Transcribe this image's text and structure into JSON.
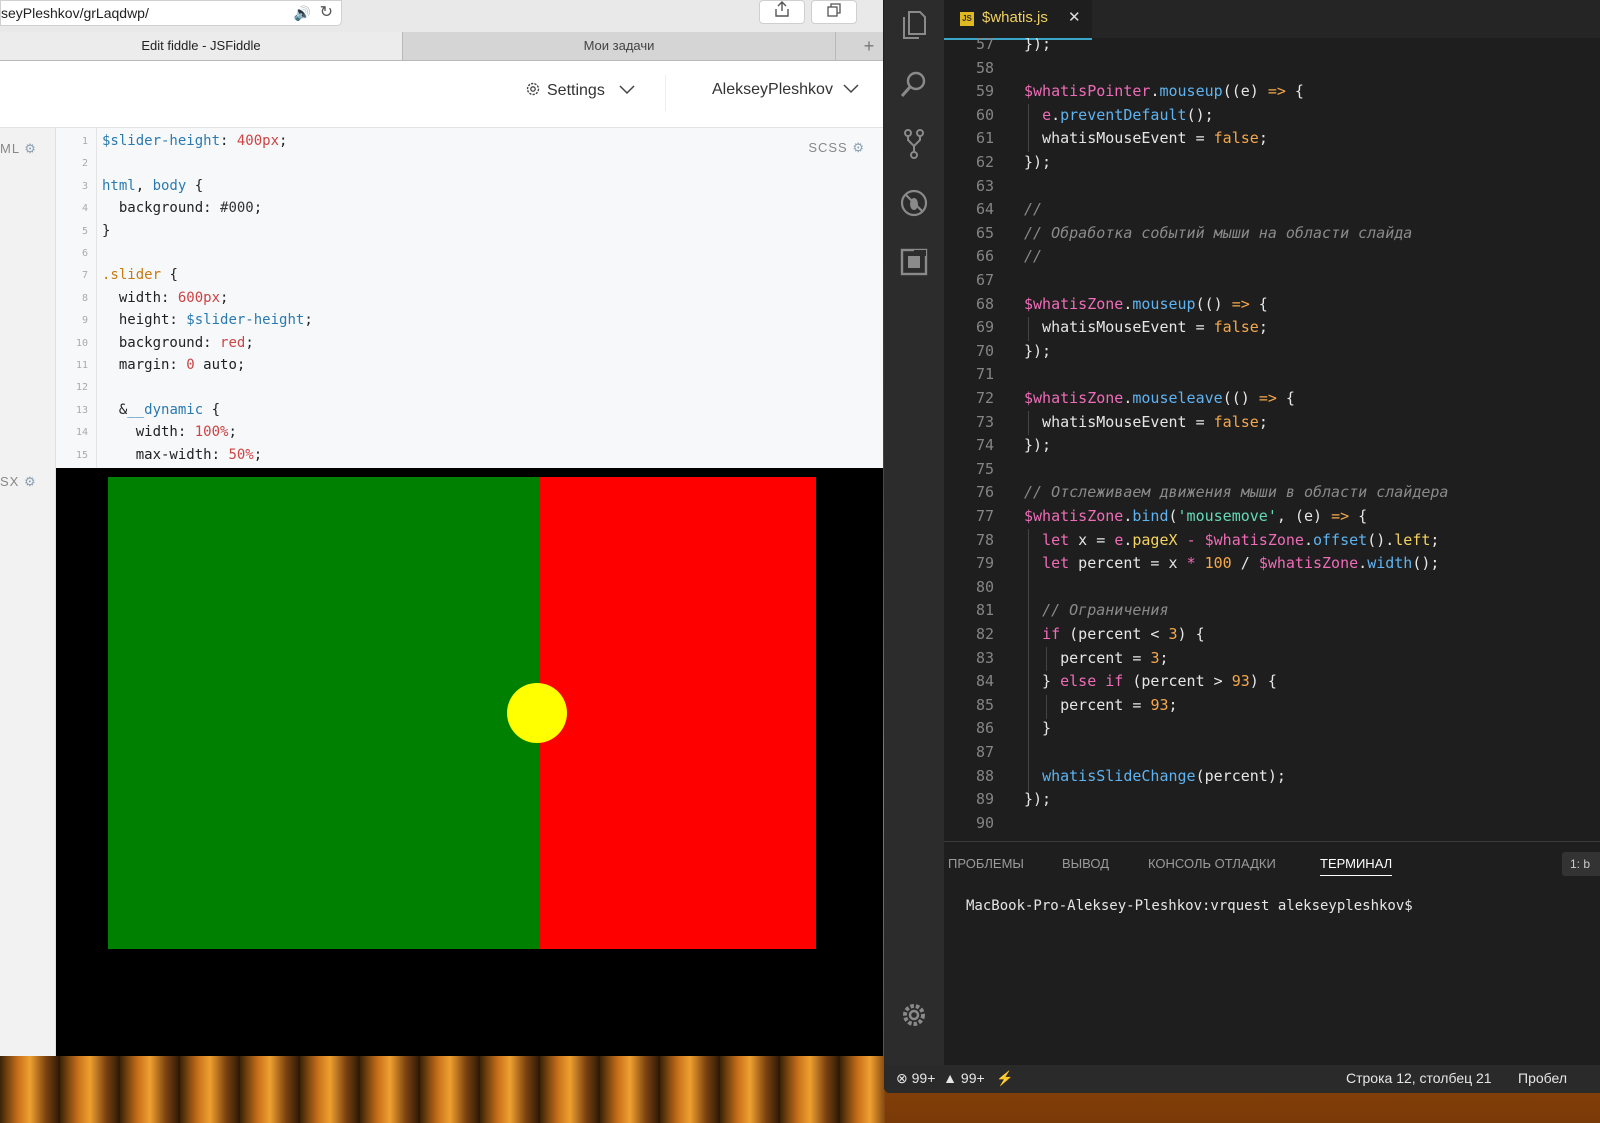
{
  "browser": {
    "url": "seyPleshkov/grLaqdwp/",
    "tabs": [
      "Edit fiddle - JSFiddle",
      "Мои задачи"
    ],
    "tab_plus": "+",
    "header": {
      "settings_label": "Settings",
      "user_label": "AlekseyPleshkov"
    },
    "pane_labels": {
      "html": "ML",
      "css": "SCSS",
      "js": "SX"
    }
  },
  "scss_lines": [
    {
      "n": "1",
      "html": "<span class=\"c-var\">$slider-height</span>: <span class=\"c-val\">400px</span>;"
    },
    {
      "n": "2",
      "html": ""
    },
    {
      "n": "3",
      "html": "<span class=\"c-kw\">html</span>, <span class=\"c-kw\">body</span> {"
    },
    {
      "n": "4",
      "html": "  background: <span class=\"c-hex\">#000</span>;"
    },
    {
      "n": "5",
      "html": "}"
    },
    {
      "n": "6",
      "html": ""
    },
    {
      "n": "7",
      "html": "<span class=\"c-sel\">.slider</span> {"
    },
    {
      "n": "8",
      "html": "  width: <span class=\"c-val\">600px</span>;"
    },
    {
      "n": "9",
      "html": "  height: <span class=\"c-var\">$slider-height</span>;"
    },
    {
      "n": "10",
      "html": "  background: <span class=\"c-val\">red</span>;"
    },
    {
      "n": "11",
      "html": "  margin: <span class=\"c-val\">0</span> auto;"
    },
    {
      "n": "12",
      "html": ""
    },
    {
      "n": "13",
      "html": "  &amp;<span class=\"c-kw\">__dynamic</span> {"
    },
    {
      "n": "14",
      "html": "    width: <span class=\"c-val\">100%</span>;"
    },
    {
      "n": "15",
      "html": "    max-width: <span class=\"c-val\">50%</span>;"
    }
  ],
  "result": {
    "left_color": "#008000",
    "right_color": "#ff0000",
    "handle_color": "#ffff00"
  },
  "vscode": {
    "tab_name": "$whatis.js",
    "tab_badge": "JS",
    "code_lines": [
      {
        "n": "57",
        "html": "});"
      },
      {
        "n": "58",
        "html": ""
      },
      {
        "n": "59",
        "html": "<span class=\"k-pink\">$whatisPointer</span>.<span class=\"k-blue\">mouseup</span>((e) <span class=\"k-orange\">=&gt;</span> {"
      },
      {
        "n": "60",
        "html": "  <span class=\"k-pink\">e</span>.<span class=\"k-blue\">preventDefault</span>();"
      },
      {
        "n": "61",
        "html": "  whatisMouseEvent = <span class=\"k-orange\">false</span>;"
      },
      {
        "n": "62",
        "html": "});"
      },
      {
        "n": "63",
        "html": ""
      },
      {
        "n": "64",
        "html": "<span class=\"k-cmt\">//</span>"
      },
      {
        "n": "65",
        "html": "<span class=\"k-cmt\">// Обработка событий мыши на области слайда</span>"
      },
      {
        "n": "66",
        "html": "<span class=\"k-cmt\">//</span>"
      },
      {
        "n": "67",
        "html": ""
      },
      {
        "n": "68",
        "html": "<span class=\"k-pink\">$whatisZone</span>.<span class=\"k-blue\">mouseup</span>(() <span class=\"k-orange\">=&gt;</span> {"
      },
      {
        "n": "69",
        "html": "  whatisMouseEvent = <span class=\"k-orange\">false</span>;"
      },
      {
        "n": "70",
        "html": "});"
      },
      {
        "n": "71",
        "html": ""
      },
      {
        "n": "72",
        "html": "<span class=\"k-pink\">$whatisZone</span>.<span class=\"k-blue\">mouseleave</span>(() <span class=\"k-orange\">=&gt;</span> {"
      },
      {
        "n": "73",
        "html": "  whatisMouseEvent = <span class=\"k-orange\">false</span>;"
      },
      {
        "n": "74",
        "html": "});"
      },
      {
        "n": "75",
        "html": ""
      },
      {
        "n": "76",
        "html": "<span class=\"k-cmt\">// Отслеживаем движения мыши в области слайдера</span>"
      },
      {
        "n": "77",
        "html": "<span class=\"k-pink\">$whatisZone</span>.<span class=\"k-blue\">bind</span>(<span class=\"k-str\">'mousemove'</span>, (e) <span class=\"k-orange\">=&gt;</span> {"
      },
      {
        "n": "78",
        "html": "  <span class=\"k-pink\">let</span> x = <span class=\"k-pink\">e</span>.<span class=\"k-yel\">pageX</span> <span class=\"k-pink\">-</span> <span class=\"k-pink\">$whatisZone</span>.<span class=\"k-blue\">offset</span>().<span class=\"k-yel\">left</span>;"
      },
      {
        "n": "79",
        "html": "  <span class=\"k-pink\">let</span> percent = x <span class=\"k-pink\">*</span> <span class=\"k-orange\">100</span> / <span class=\"k-pink\">$whatisZone</span>.<span class=\"k-blue\">width</span>();"
      },
      {
        "n": "80",
        "html": ""
      },
      {
        "n": "81",
        "html": "  <span class=\"k-cmt\">// Ограничения</span>"
      },
      {
        "n": "82",
        "html": "  <span class=\"k-pink\">if</span> (percent &lt; <span class=\"k-orange\">3</span>) {"
      },
      {
        "n": "83",
        "html": "    percent = <span class=\"k-orange\">3</span>;"
      },
      {
        "n": "84",
        "html": "  } <span class=\"k-pink\">else if</span> (percent &gt; <span class=\"k-orange\">93</span>) {"
      },
      {
        "n": "85",
        "html": "    percent = <span class=\"k-orange\">93</span>;"
      },
      {
        "n": "86",
        "html": "  }"
      },
      {
        "n": "87",
        "html": ""
      },
      {
        "n": "88",
        "html": "  <span class=\"k-blue\">whatisSlideChange</span>(percent);"
      },
      {
        "n": "89",
        "html": "});"
      },
      {
        "n": "90",
        "html": ""
      }
    ],
    "panel_tabs": [
      "ПРОБЛЕМЫ",
      "ВЫВОД",
      "КОНСОЛЬ ОТЛАДКИ",
      "ТЕРМИНАЛ"
    ],
    "terminal_selector": "1: b",
    "terminal_prompt": "MacBook-Pro-Aleksey-Pleshkov:vrquest alekseypleshkov$",
    "status": {
      "errors": "99+",
      "warnings": "99+",
      "bolt": "⚡",
      "position": "Строка 12, столбец 21",
      "indent": "Пробел"
    }
  }
}
